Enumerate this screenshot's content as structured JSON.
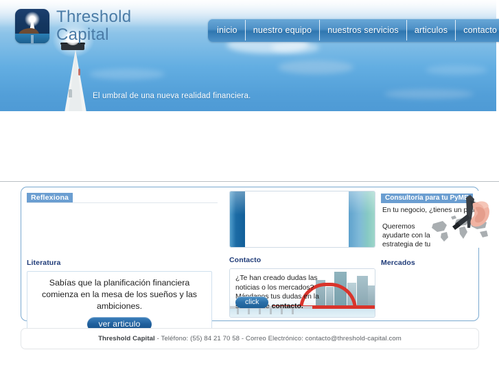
{
  "site": {
    "brand_line1": "Threshold",
    "brand_line2": "Capital",
    "logo_icon": "lighthouse-icon",
    "tagline": "El umbral de una nueva realidad financiera."
  },
  "nav": {
    "items": [
      {
        "label": "inicio"
      },
      {
        "label": "nuestro equipo"
      },
      {
        "label": "nuestros servicios"
      },
      {
        "label": "articulos"
      },
      {
        "label": "contacto"
      }
    ]
  },
  "main": {
    "left": {
      "section_label": "Reflexiona",
      "sub_head": "Literatura",
      "quote": "Sabías que la planificación financiera comienza en la mesa de los sueños y las ambiciones.",
      "cta": "ver articulo"
    },
    "middle": {
      "sub_head": "Contacto",
      "card_text_1": "¿Te han creado dudas las noticias o los mercados? Mándanos tus dudas en la sección de ",
      "card_text_strong": "contacto.",
      "cta": "click"
    },
    "right": {
      "section_label": "Consultoría para tu PyME",
      "line_1": "En tu negocio, ¿tienes un plan?",
      "line_2": "Queremos ayudarte con la estrategia de tu PyME",
      "sub_head": "Mercados"
    }
  },
  "footer": {
    "brand": "Threshold Capital",
    "rest": " -  Teléfono: (55) 84 21 70 58 - Correo Electrónico: contacto@threshold-capital.com"
  },
  "colors": {
    "nav_blue": "#2f76b0",
    "label_blue": "#6b9ed1",
    "heading_navy": "#1f3b78",
    "accent_red": "#d9342b",
    "teal": "#8fcfc6",
    "panel_border": "#7aa9d0"
  }
}
